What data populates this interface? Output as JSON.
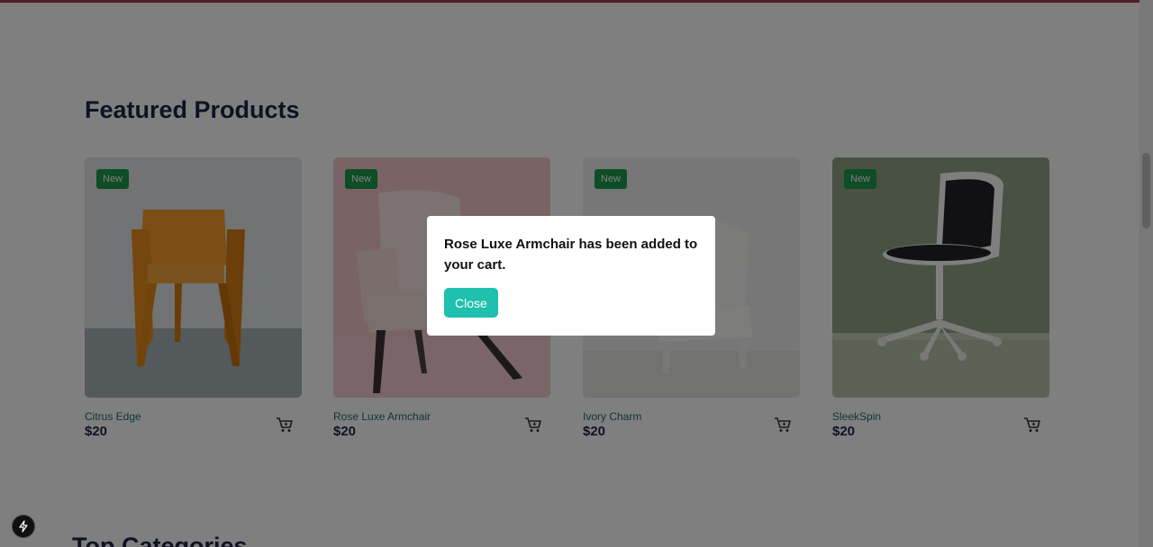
{
  "featured": {
    "title": "Featured Products",
    "products": [
      {
        "badge": "New",
        "name": "Citrus Edge",
        "price": "$20",
        "image": "orange-chair",
        "accent": "#e8891e"
      },
      {
        "badge": "New",
        "name": "Rose Luxe Armchair",
        "price": "$20",
        "image": "pink-armchair",
        "accent": "#f0c4c4"
      },
      {
        "badge": "New",
        "name": "Ivory Charm",
        "price": "$20",
        "image": "white-chair",
        "accent": "#e6e6e2"
      },
      {
        "badge": "New",
        "name": "SleekSpin",
        "price": "$20",
        "image": "office-chair",
        "accent": "#8c9c7e"
      }
    ],
    "cart_icon": "cart-icon"
  },
  "categories": {
    "title": "Top Categories"
  },
  "modal": {
    "message": "Rose Luxe Armchair has been added to your cart.",
    "close_label": "Close"
  },
  "colors": {
    "badge": "#1c9a4b",
    "close_button": "#1fc0ad",
    "heading": "#1f2447",
    "product_name": "#1c6e6a"
  }
}
